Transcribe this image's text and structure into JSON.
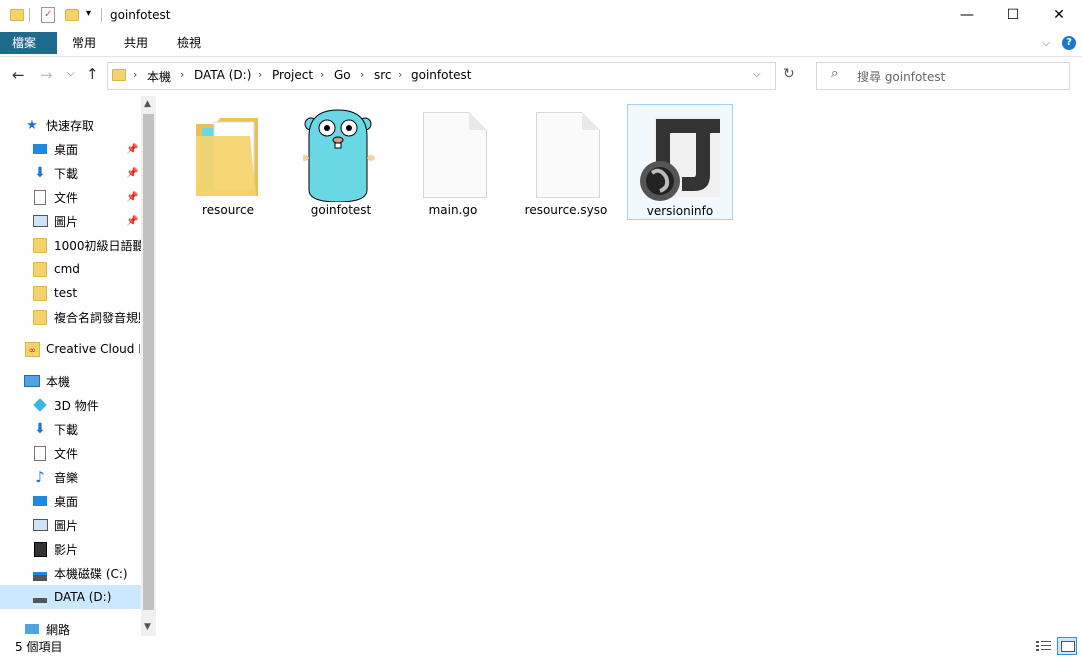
{
  "window": {
    "title": "goinfotest",
    "minimize": "—",
    "maximize": "☐",
    "close": "✕"
  },
  "ribbon": {
    "tabs": [
      "檔案",
      "常用",
      "共用",
      "檢視"
    ],
    "help": "?"
  },
  "address": {
    "breadcrumbs": [
      "本機",
      "DATA (D:)",
      "Project",
      "Go",
      "src",
      "goinfotest"
    ],
    "search_placeholder": "搜尋 goinfotest"
  },
  "nav": {
    "quick_access": "快速存取",
    "quick_items": [
      "桌面",
      "下載",
      "文件",
      "圖片",
      "1000初級日語聽",
      "cmd",
      "test",
      "複合名詞發音規則"
    ],
    "creative_cloud": "Creative Cloud Fi",
    "this_pc": "本機",
    "pc_items": [
      "3D 物件",
      "下載",
      "文件",
      "音樂",
      "桌面",
      "圖片",
      "影片",
      "本機磁碟 (C:)",
      "DATA (D:)"
    ],
    "network": "網路"
  },
  "files": [
    {
      "name": "resource",
      "type": "folder"
    },
    {
      "name": "goinfotest",
      "type": "executable"
    },
    {
      "name": "main.go",
      "type": "document"
    },
    {
      "name": "resource.syso",
      "type": "document"
    },
    {
      "name": "versioninfo",
      "type": "json"
    }
  ],
  "status": {
    "count": "5 個項目"
  },
  "colors": {
    "accent": "#1e6a8c",
    "selection": "#99d1ff",
    "folder": "#f5d36b",
    "gopher": "#6ad7e5"
  }
}
